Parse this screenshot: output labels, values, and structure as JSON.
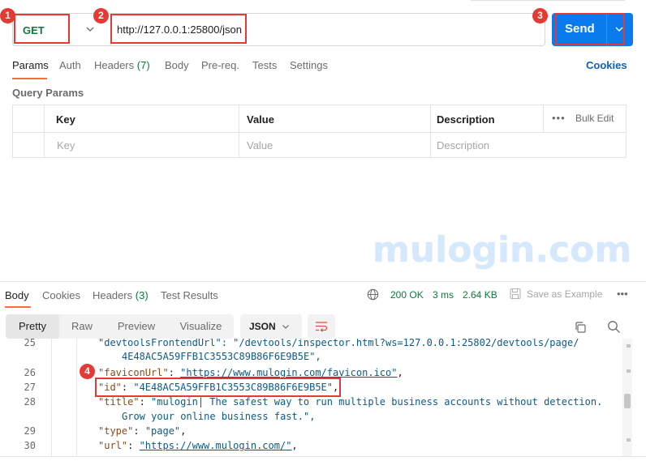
{
  "request": {
    "method": "GET",
    "url": "http://127.0.0.1:25800/json",
    "send_label": "Send"
  },
  "annotations": [
    "1",
    "2",
    "3",
    "4"
  ],
  "tabs": [
    {
      "label": "Params"
    },
    {
      "label": "Auth"
    },
    {
      "label": "Headers",
      "count": "(7)"
    },
    {
      "label": "Body"
    },
    {
      "label": "Pre-req."
    },
    {
      "label": "Tests"
    },
    {
      "label": "Settings"
    }
  ],
  "cookies_label": "Cookies",
  "query_params": {
    "title": "Query Params",
    "headers": [
      "Key",
      "Value",
      "Description"
    ],
    "placeholders": [
      "Key",
      "Value",
      "Description"
    ],
    "bulk_edit": "Bulk Edit",
    "more": "•••"
  },
  "watermark": "mulogin.com",
  "response": {
    "tabs": [
      {
        "label": "Body"
      },
      {
        "label": "Cookies"
      },
      {
        "label": "Headers",
        "count": "(3)"
      },
      {
        "label": "Test Results"
      }
    ],
    "status": "200 OK",
    "time": "3 ms",
    "size": "2.64 KB",
    "save_example": "Save as Example",
    "more": "•••",
    "views": [
      "Pretty",
      "Raw",
      "Preview",
      "Visualize"
    ],
    "format": "JSON"
  },
  "code_lines": {
    "l25_num": "25",
    "l25_a": "\"devtoolsFrontendUrl\": \"/devtools/inspector.html?ws=127.0.0.1:25802/devtools/page/",
    "l25_b": "4E48AC5A59FFB1C3553C89B86F6E9B5E\",",
    "l26_num": "26",
    "l26_key": "\"faviconUrl\"",
    "l26_val": "\"https://www.mulogin.com/favicon.ico\"",
    "l27_num": "27",
    "l27_key": "\"id\"",
    "l27_val": "\"4E48AC5A59FFB1C3553C89B86F6E9B5E\"",
    "l28_num": "28",
    "l28_key": "\"title\"",
    "l28_val_a": "\"mulogin| The safest way to run multiple business accounts without detection.",
    "l28_val_b": "Grow your online business fast.\",",
    "l29_num": "29",
    "l29_key": "\"type\"",
    "l29_val": "\"page\"",
    "l30_num": "30",
    "l30_key": "\"url\"",
    "l30_val": "\"https://www.mulogin.com/\""
  },
  "colors": {
    "accent": "#ff6c37",
    "send": "#097bed",
    "annotation": "#e53935",
    "method": "#0c7a3b"
  }
}
